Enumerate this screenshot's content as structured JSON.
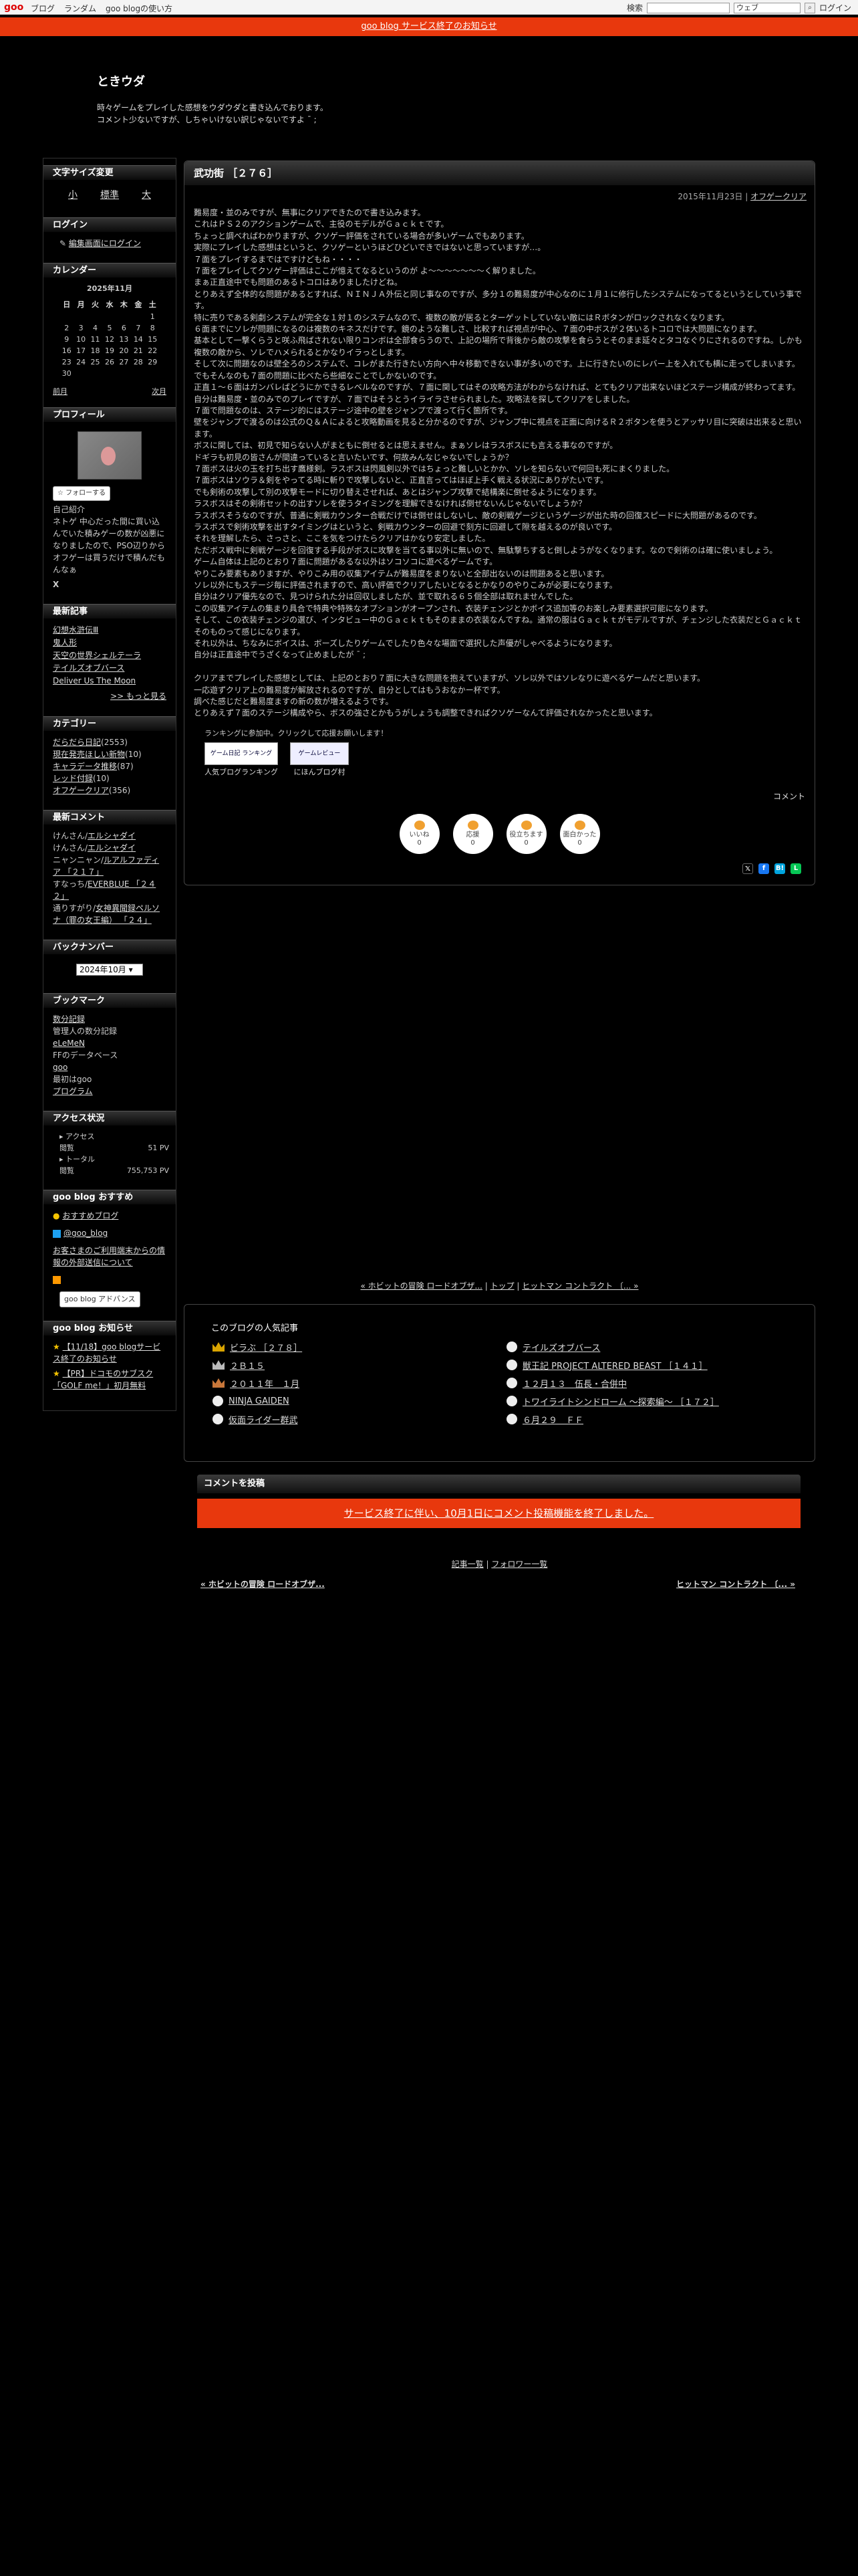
{
  "topbar": {
    "logo": "goo",
    "links": [
      "ブログ",
      "ランダム",
      "goo blogの使い方"
    ],
    "search_label": "検索",
    "search_scope": "ウェブ",
    "login": "ログイン"
  },
  "notice": "goo blog サービス終了のお知らせ",
  "header": {
    "title": "ときウダ",
    "description": "時々ゲームをプレイした感想をウダウダと書き込んでおります。\nコメント少ないですが、しちゃいけない訳じゃないですよ ¯ ;"
  },
  "sidebar": {
    "fontsize": {
      "title": "文字サイズ変更",
      "options": [
        "小",
        "標準",
        "大"
      ]
    },
    "login": {
      "title": "ログイン",
      "link": "編集画面にログイン"
    },
    "calendar": {
      "title": "カレンダー",
      "month": "2025年11月",
      "weekdays": [
        "日",
        "月",
        "火",
        "水",
        "木",
        "金",
        "土"
      ],
      "weeks": [
        [
          "",
          "",
          "",
          "",
          "",
          "",
          "1"
        ],
        [
          "2",
          "3",
          "4",
          "5",
          "6",
          "7",
          "8"
        ],
        [
          "9",
          "10",
          "11",
          "12",
          "13",
          "14",
          "15"
        ],
        [
          "16",
          "17",
          "18",
          "19",
          "20",
          "21",
          "22"
        ],
        [
          "23",
          "24",
          "25",
          "26",
          "27",
          "28",
          "29"
        ],
        [
          "30",
          "",
          "",
          "",
          "",
          "",
          ""
        ]
      ],
      "prev": "前月",
      "next": "次月"
    },
    "profile": {
      "title": "プロフィール",
      "follow": "フォローする",
      "intro_label": "自己紹介",
      "intro": "ネトゲ 中心だった間に買い込んでいた積みゲーの数が凶悪になりましたので、PSO辺りからオフゲーは買うだけで積んだもんなぁ",
      "x": "X"
    },
    "recent_posts": {
      "title": "最新記事",
      "items": [
        "幻想水滸伝Ⅲ",
        "鬼人形",
        "天空の世界シェルテーラ",
        "テイルズオブバース",
        "Deliver Us The Moon"
      ],
      "more": ">> もっと見る"
    },
    "categories": {
      "title": "カテゴリー",
      "items": [
        {
          "name": "だらだら日記",
          "count": "(2553)"
        },
        {
          "name": "現在発売ほしい新物",
          "count": "(10)"
        },
        {
          "name": "キャラデータ推移",
          "count": "(87)"
        },
        {
          "name": "レッド付録",
          "count": "(10)"
        },
        {
          "name": "オフゲークリア",
          "count": "(356)"
        }
      ]
    },
    "recent_comments": {
      "title": "最新コメント",
      "items": [
        {
          "who": "けんさん/",
          "link": "エルシャダイ"
        },
        {
          "who": "けんさん/",
          "link": "エルシャダイ"
        },
        {
          "who": "ニャンニャン/",
          "link": "ルアルファディア 「２１７」"
        },
        {
          "who": "すなっち/",
          "link": "EVERBLUE 「２４２」"
        },
        {
          "who": "通りすがり/",
          "link": "女神異聞録ペルソナ（罪の女王編） 「２４」"
        }
      ]
    },
    "backnumber": {
      "title": "バックナンバー",
      "selected": "2024年10月"
    },
    "bookmarks": {
      "title": "ブックマーク",
      "items": [
        {
          "link": "数分記録",
          "desc": "管理人の数分記録"
        },
        {
          "link": "eLeMeN",
          "desc": "FFのデータベース"
        },
        {
          "link": "goo",
          "desc": "最初はgoo"
        },
        {
          "link": "プログラム",
          "desc": ""
        }
      ]
    },
    "access": {
      "title": "アクセス状況",
      "label_access": "アクセス",
      "label_total": "トータル",
      "views": "閲覧",
      "access_pv": "51 PV",
      "total_pv": "755,753 PV"
    },
    "recommend": {
      "title": "goo blog おすすめ",
      "link": "おすすめブログ",
      "twitter": "@goo_blog",
      "guide": "お客さまのご利用端末からの情報の外部送信について",
      "adv": "goo blog アドバンス"
    },
    "news": {
      "title": "goo blog お知らせ",
      "items": [
        "【11/18】goo blogサービス終了のお知らせ",
        "【PR】ドコモのサブスク「GOLF me！」初月無料"
      ]
    }
  },
  "post": {
    "title": "武功街 ［２７６］",
    "date": "2015年11月23日",
    "category": "オフゲークリア",
    "body": "難易度・並のみですが、無事にクリアできたので書き込みます。\nこれはＰＳ２のアクションゲームで、主役のモデルがＧａｃｋｔです。\nちょっと調べればわかりますが、クソゲー評価をされている場合が多いゲームでもあります。\n実際にプレイした感想はというと、クソゲーというほどひどいできではないと思っていますが…。\n７面をプレイするまではですけどもね・・・・\n７面をプレイしてクソゲー評価はここが憶えてなるというのが よ〜〜〜〜〜〜〜く解りました。\nまぁ正直途中でも問題のあるトコロはありましたけどね。\nとりあえず全体的な問題があるとすれば、ＮＩＮＪＡ外伝と同じ事なのですが、多分１の難易度が中心なのに１月１に修行したシステムになってるというとしていう事です。\n特に売りである剣劇システムが完全な１対１のシステムなので、複数の敵が居るとターゲットしていない敵にはＲボタンがロックされなくなります。\n６面までにソレが問題になるのは複数のキネスだけです。鏡のような難しさ、比較すれば視点が中心、７面の中ボスが２体いるトコロでは大問題になります。\n基本として一撃くらうと咲ふ飛ばされない限りコンボは全部食らうので、上記の場所で背後から敵の攻撃を食らうとそのまま延々とタコなぐりにされるのですね。しかも複数の敵から、ソレでハメられるとかなりイラっとします。\nそして次に問題なのは壁全ろのシステムで、コレがまた行きたい方向へ中々移動できない事が多いのです。上に行きたいのにレバー上を入れても横に走ってしまいます。\nでもそんなのも７面の問題に比べたら些細なことでしかないのです。\n正直１〜６面はガンバレばどうにかできるレベルなのですが、７面に関してはその攻略方法がわからなければ、とてもクリア出来ないほどステージ構成が終わってます。\n自分は難易度・並のみでのプレイですが、７面ではそうとうイライラさせられました。攻略法を探してクリアをしました。\n７面で問題なのは、ステージ的にはステージ途中の壁をジャンプで渡って行く箇所です。\n壁をジャンプで渡るのは公式のＱ＆Ａによると攻略動画を見ると分かるのですが、ジャンプ中に視点を正面に向けるＲ２ボタンを使うとアッサリ目に突破は出来ると思います。\nボスに関しては、初見で知らない人がまともに倒せるとは思えません。まぁソレはラスボスにも言える事なのですが。\nドギラも初見の皆さんが間違っていると言いたいです、何故みんなじゃないでしょうか？\n７面ボスは火の玉を打ち出す鷹様剣。ラスボスは閃風剣以外ではちょっと難しいとかか、ソレを知らないで何回も死にまくりました。\n７面ボスはソウラ＆剣をやってる時に斬りで攻撃しないと、正直言ってはほぼ上手く戦える状況にありがたいです。\nでも剣術の攻撃して別の攻撃モードに切り替えさせれば、あとはジャンプ攻撃で結構楽に倒せるようになります。\nラスボスはその剣術セットの出すソレを使うタイミングを理解できなければ倒せないんじゃないでしょうか？\nラスボスそうなのですが、普通に剣戦カウンター合戦だけでは倒せはしないし、敵の剣戦ゲージというゲージが出た時の回復スピードに大問題があるのです。\nラスボスで剣術攻撃を出すタイミングはというと、剣戦カウンターの回避で刻方に回避して隙を越えるのが良いです。\nそれを理解したら、さっさと、ここを気をつけたらクリアはかなり安定しました。\nただボス戦中に剣戦ゲージを回復する手段がボスに攻撃を当てる事以外に無いので、無駄撃ちすると倒しようがなくなります。なので剣術のは確に使いましょう。\nゲーム自体は上記のとおり７面に問題があるな以外はソコソコに遊べるゲームです。\nやりこみ要素もありますが、やりこみ用の収集アイテムが難易度をまりないと全部出ないのは問題あると思います。\nソレ以外にもステージ毎に評価されますので、高い評価でクリアしたいとなるとかなりのやりこみが必要になります。\n自分はクリア優先なので、見つけられた分は回収しましたが、並で取れる６５個全部は取れませんでした。\nこの収集アイテムの集まり具合で特典や特殊なオプションがオープンされ、衣装チェンジとかボイス追加等のお楽しみ要素選択可能になります。\nそして、この衣装チェンジの選び、インタビュー中のＧａｃｋｔもそのままの衣装なんですね。通常の服はＧａｃｋｔがモデルですが、チェンジした衣装だとＧａｃｋｔそのものって感じになります。\nそれ以外は、ちなみにボイスは、ボーズしたりゲームでしたり色々な場面で選択した声優がしゃべるようになります。\n自分は正直途中でうざくなって止めましたが ¯ ;\n\nクリアまでプレイした感想としては、上記のとおり７面に大きな問題を抱えていますが、ソレ以外ではソレなりに遊べるゲームだと思います。\n一応遊ずクリア上の難易度が解放されるのですが、自分としてはもうおなかー杯です。\n調べた感じだと難易度ますの新の数が増えるようです。\nとりあえず７面のステージ構成やら、ボスの強さとかもうがしょうも調整できれぱクソゲーなんて評価されなかったと思います。",
    "ranking_intro": "ランキングに参加中。クリックして応援お願いします！",
    "ranking": [
      {
        "img": "ゲーム日記 ランキング",
        "label": "人気ブログランキング"
      },
      {
        "img": "ゲームレビュー",
        "label": "にほんブログ村"
      }
    ],
    "comment_link": "コメント",
    "reactions": [
      {
        "label": "いいね",
        "count": "0"
      },
      {
        "label": "応援",
        "count": "0"
      },
      {
        "label": "役立ちます",
        "count": "0"
      },
      {
        "label": "面白かった",
        "count": "0"
      }
    ]
  },
  "pager": {
    "prev": "« ホビットの冒険 ロードオブザ...",
    "top": "トップ",
    "next": "ヒットマン コントラクト 〔... »",
    "prev2": "« ホビットの冒険 ロードオブザ...",
    "next2": "ヒットマン コントラクト 〔... »"
  },
  "popular": {
    "title": "このブログの人気記事",
    "items": [
      {
        "rank": "gold",
        "text": "ビラぶ ［２７８］"
      },
      {
        "rank": "",
        "text": "テイルズオブバース"
      },
      {
        "rank": "silver",
        "text": "２Ｂ１５"
      },
      {
        "rank": "",
        "text": "獣王記 PROJECT ALTERED BEAST ［１４１］"
      },
      {
        "rank": "bronze",
        "text": "２０１１年　１月"
      },
      {
        "rank": "",
        "text": "１２月１３　伍長・合併中"
      },
      {
        "rank": "",
        "text": "NINJA GAIDEN"
      },
      {
        "rank": "",
        "text": "トワイライトシンドローム 〜探索編〜 ［１７２］"
      },
      {
        "rank": "",
        "text": "仮面ライダー群武"
      },
      {
        "rank": "",
        "text": "６月２９　ＦＦ"
      }
    ]
  },
  "comment_post": {
    "title": "コメントを投稿",
    "closed": "サービス終了に伴い、10月1日にコメント投稿機能を終了しました。"
  },
  "bottom_links": {
    "list": "記事一覧",
    "follower": "フォロワー一覧"
  }
}
